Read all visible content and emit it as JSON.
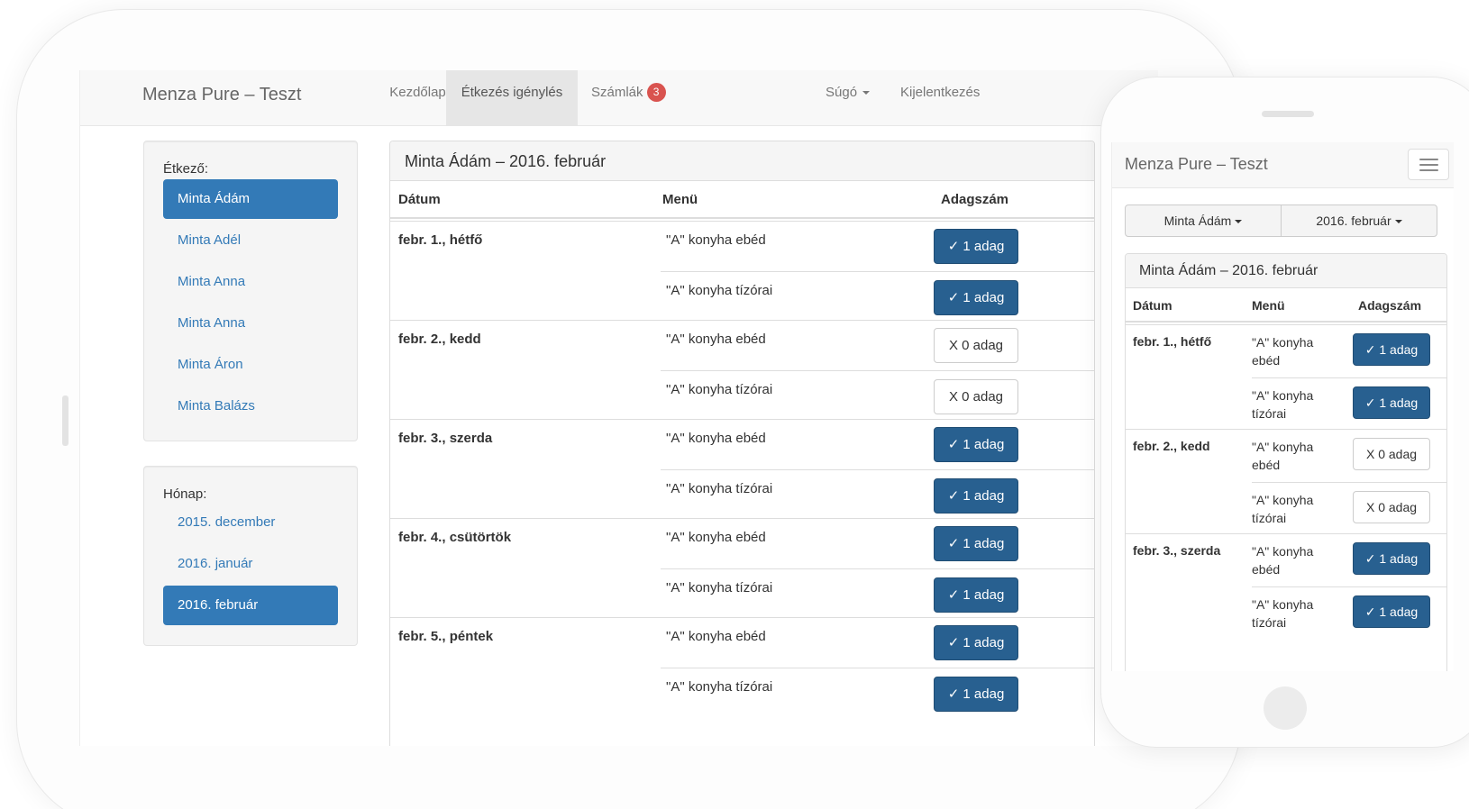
{
  "colors": {
    "primary": "#337ab7",
    "primary_dark": "#286090",
    "badge": "#d9534f",
    "navbar_bg": "#f8f8f8"
  },
  "desktop": {
    "brand": "Menza Pure – Teszt",
    "nav": {
      "home": "Kezdőlap",
      "meal_request": "Étkezés igénylés",
      "invoices": "Számlák",
      "invoices_badge": "3",
      "help": "Súgó",
      "logout": "Kijelentkezés"
    },
    "diner_heading": "Étkező:",
    "diners": [
      "Minta Ádám",
      "Minta Adél",
      "Minta Anna",
      "Minta Anna",
      "Minta Áron",
      "Minta Balázs"
    ],
    "month_heading": "Hónap:",
    "months": [
      "2015. december",
      "2016. január",
      "2016. február"
    ],
    "panel_title": "Minta Ádám – 2016. február",
    "columns": {
      "date": "Dátum",
      "menu": "Menü",
      "portions": "Adagszám"
    },
    "days": [
      {
        "label": "febr. 1., hétfő",
        "meals": [
          {
            "name": "\"A\" konyha ebéd",
            "btn": "✓ 1 adag",
            "on": true
          },
          {
            "name": "\"A\" konyha tízórai",
            "btn": "✓ 1 adag",
            "on": true
          }
        ]
      },
      {
        "label": "febr. 2., kedd",
        "meals": [
          {
            "name": "\"A\" konyha ebéd",
            "btn": "X 0 adag",
            "on": false
          },
          {
            "name": "\"A\" konyha tízórai",
            "btn": "X 0 adag",
            "on": false
          }
        ]
      },
      {
        "label": "febr. 3., szerda",
        "meals": [
          {
            "name": "\"A\" konyha ebéd",
            "btn": "✓ 1 adag",
            "on": true
          },
          {
            "name": "\"A\" konyha tízórai",
            "btn": "✓ 1 adag",
            "on": true
          }
        ]
      },
      {
        "label": "febr. 4., csütörtök",
        "meals": [
          {
            "name": "\"A\" konyha ebéd",
            "btn": "✓ 1 adag",
            "on": true
          },
          {
            "name": "\"A\" konyha tízórai",
            "btn": "✓ 1 adag",
            "on": true
          }
        ]
      },
      {
        "label": "febr. 5., péntek",
        "meals": [
          {
            "name": "\"A\" konyha ebéd",
            "btn": "✓ 1 adag",
            "on": true
          },
          {
            "name": "\"A\" konyha tízórai",
            "btn": "✓ 1 adag",
            "on": true
          }
        ]
      }
    ]
  },
  "mobile": {
    "brand": "Menza Pure – Teszt",
    "diner_dropdown": "Minta Ádám",
    "month_dropdown": "2016. február",
    "panel_title": "Minta Ádám – 2016. február",
    "columns": {
      "date": "Dátum",
      "menu": "Menü",
      "portions": "Adagszám"
    },
    "days": [
      {
        "label": "febr. 1., hétfő",
        "meals": [
          {
            "name": "\"A\" konyha ebéd",
            "btn": "✓ 1 adag",
            "on": true
          },
          {
            "name": "\"A\" konyha tízórai",
            "btn": "✓ 1 adag",
            "on": true
          }
        ]
      },
      {
        "label": "febr. 2., kedd",
        "meals": [
          {
            "name": "\"A\" konyha ebéd",
            "btn": "X 0 adag",
            "on": false
          },
          {
            "name": "\"A\" konyha tízórai",
            "btn": "X 0 adag",
            "on": false
          }
        ]
      },
      {
        "label": "febr. 3., szerda",
        "meals": [
          {
            "name": "\"A\" konyha ebéd",
            "btn": "✓ 1 adag",
            "on": true
          },
          {
            "name": "\"A\" konyha tízórai",
            "btn": "✓ 1 adag",
            "on": true
          }
        ]
      }
    ]
  }
}
